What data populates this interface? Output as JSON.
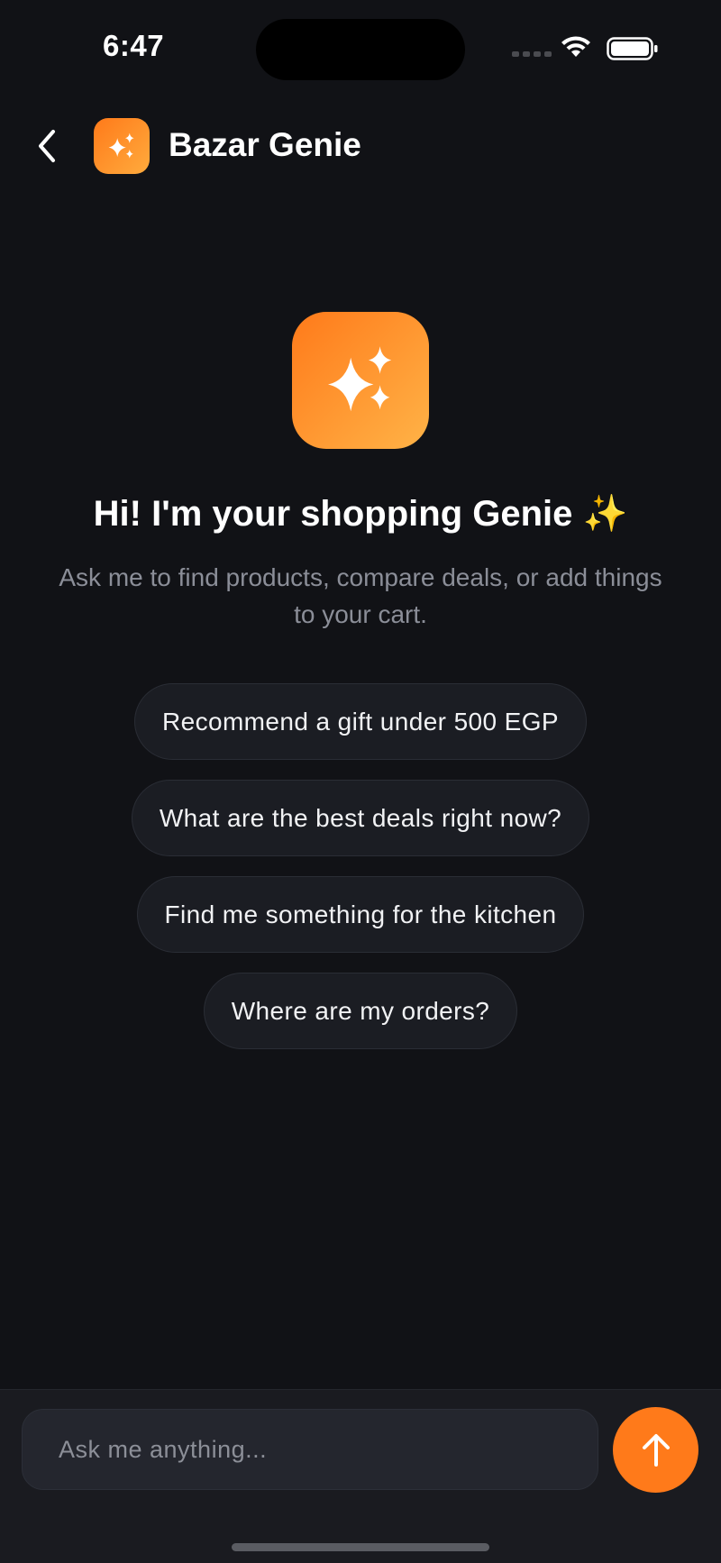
{
  "status_bar": {
    "time": "6:47"
  },
  "header": {
    "title": "Bazar Genie",
    "logo_icon": "sparkles-icon"
  },
  "hero": {
    "icon": "sparkles-icon",
    "title": "Hi! I'm your shopping Genie ✨",
    "subtitle": "Ask me to find products, compare deals, or add things to your cart."
  },
  "suggestions": [
    {
      "label": "Recommend a gift under 500 EGP"
    },
    {
      "label": "What are the best deals right now?"
    },
    {
      "label": "Find me something for the kitchen"
    },
    {
      "label": "Where are my orders?"
    }
  ],
  "composer": {
    "placeholder": "Ask me anything...",
    "value": "",
    "send_icon": "arrow-up-icon"
  },
  "colors": {
    "accent": "#ff7a1a",
    "background": "#111216"
  }
}
